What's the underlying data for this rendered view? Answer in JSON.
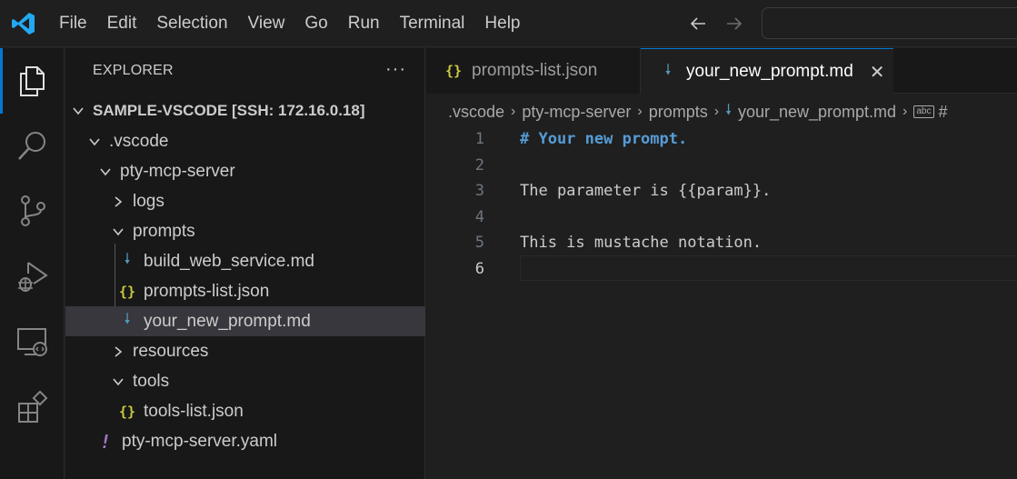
{
  "menu": [
    "File",
    "Edit",
    "Selection",
    "View",
    "Go",
    "Run",
    "Terminal",
    "Help"
  ],
  "colors": {
    "accent": "#0078d4",
    "heading": "#569cd6",
    "json_icon": "#cbcb41",
    "md_icon": "#519aba",
    "yaml_icon": "#a074c4"
  },
  "activity_bar": [
    "files-icon",
    "search-icon",
    "source-control-icon",
    "run-debug-icon",
    "remote-explorer-icon",
    "extensions-icon"
  ],
  "explorer": {
    "title": "EXPLORER",
    "more": "···",
    "root": "SAMPLE-VSCODE [SSH: 172.16.0.18]",
    "tree": [
      {
        "label": ".vscode",
        "type": "folder",
        "expanded": true
      },
      {
        "label": "pty-mcp-server",
        "type": "folder",
        "expanded": true
      },
      {
        "label": "logs",
        "type": "folder",
        "expanded": false
      },
      {
        "label": "prompts",
        "type": "folder",
        "expanded": true
      },
      {
        "label": "build_web_service.md",
        "type": "md"
      },
      {
        "label": "prompts-list.json",
        "type": "json"
      },
      {
        "label": "your_new_prompt.md",
        "type": "md",
        "selected": true
      },
      {
        "label": "resources",
        "type": "folder",
        "expanded": false
      },
      {
        "label": "tools",
        "type": "folder",
        "expanded": true
      },
      {
        "label": "tools-list.json",
        "type": "json"
      },
      {
        "label": "pty-mcp-server.yaml",
        "type": "yaml"
      }
    ]
  },
  "icons": {
    "json": "{}",
    "md": "🠗",
    "yaml": "!"
  },
  "tabs": [
    {
      "label": "prompts-list.json",
      "type": "json",
      "active": false
    },
    {
      "label": "your_new_prompt.md",
      "type": "md",
      "active": true,
      "close": "✕"
    }
  ],
  "breadcrumbs": {
    "parts": [
      ".vscode",
      "pty-mcp-server",
      "prompts",
      "your_new_prompt.md"
    ],
    "abc": "abc",
    "tail": "#"
  },
  "editor": {
    "lines": [
      {
        "n": "1",
        "text": "# Your new prompt.",
        "heading": true
      },
      {
        "n": "2",
        "text": ""
      },
      {
        "n": "3",
        "text": "The parameter is {{param}}."
      },
      {
        "n": "4",
        "text": ""
      },
      {
        "n": "5",
        "text": "This is mustache notation."
      },
      {
        "n": "6",
        "text": "",
        "current": true
      }
    ]
  }
}
